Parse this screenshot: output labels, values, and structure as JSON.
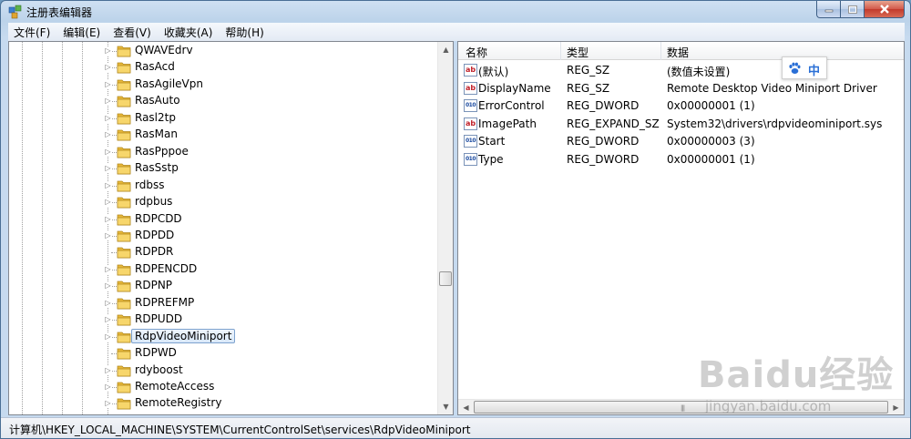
{
  "window": {
    "title": "注册表编辑器"
  },
  "menu": [
    "文件(F)",
    "编辑(E)",
    "查看(V)",
    "收藏夹(A)",
    "帮助(H)"
  ],
  "tree": {
    "items": [
      {
        "label": "QWAVEdrv",
        "expandable": true
      },
      {
        "label": "RasAcd",
        "expandable": true
      },
      {
        "label": "RasAgileVpn",
        "expandable": true
      },
      {
        "label": "RasAuto",
        "expandable": true
      },
      {
        "label": "Rasl2tp",
        "expandable": true
      },
      {
        "label": "RasMan",
        "expandable": true
      },
      {
        "label": "RasPppoe",
        "expandable": true
      },
      {
        "label": "RasSstp",
        "expandable": true
      },
      {
        "label": "rdbss",
        "expandable": true
      },
      {
        "label": "rdpbus",
        "expandable": true
      },
      {
        "label": "RDPCDD",
        "expandable": true
      },
      {
        "label": "RDPDD",
        "expandable": true
      },
      {
        "label": "RDPDR",
        "expandable": false
      },
      {
        "label": "RDPENCDD",
        "expandable": true
      },
      {
        "label": "RDPNP",
        "expandable": true
      },
      {
        "label": "RDPREFMP",
        "expandable": true
      },
      {
        "label": "RDPUDD",
        "expandable": true
      },
      {
        "label": "RdpVideoMiniport",
        "expandable": true,
        "selected": true
      },
      {
        "label": "RDPWD",
        "expandable": false
      },
      {
        "label": "rdyboost",
        "expandable": true
      },
      {
        "label": "RemoteAccess",
        "expandable": true
      },
      {
        "label": "RemoteRegistry",
        "expandable": true
      }
    ]
  },
  "list": {
    "columns": [
      "名称",
      "类型",
      "数据"
    ],
    "rows": [
      {
        "icon": "string-value-icon",
        "kind": "sz",
        "name": "(默认)",
        "type": "REG_SZ",
        "data": "(数值未设置)"
      },
      {
        "icon": "string-value-icon",
        "kind": "sz",
        "name": "DisplayName",
        "type": "REG_SZ",
        "data": "Remote Desktop Video Miniport Driver"
      },
      {
        "icon": "binary-value-icon",
        "kind": "dw",
        "name": "ErrorControl",
        "type": "REG_DWORD",
        "data": "0x00000001 (1)"
      },
      {
        "icon": "string-value-icon",
        "kind": "sz",
        "name": "ImagePath",
        "type": "REG_EXPAND_SZ",
        "data": "System32\\drivers\\rdpvideominiport.sys"
      },
      {
        "icon": "binary-value-icon",
        "kind": "dw",
        "name": "Start",
        "type": "REG_DWORD",
        "data": "0x00000003 (3)"
      },
      {
        "icon": "binary-value-icon",
        "kind": "dw",
        "name": "Type",
        "type": "REG_DWORD",
        "data": "0x00000001 (1)"
      }
    ]
  },
  "ime": {
    "label": "中"
  },
  "status": {
    "path": "计算机\\HKEY_LOCAL_MACHINE\\SYSTEM\\CurrentControlSet\\services\\RdpVideoMiniport"
  },
  "watermark": {
    "logo": "Baidu经验",
    "url": "jingyan.baidu.com"
  },
  "colors": {
    "titlebar": "#bcd3ea",
    "selection": "#d9e8f9",
    "close": "#c23a2b"
  }
}
